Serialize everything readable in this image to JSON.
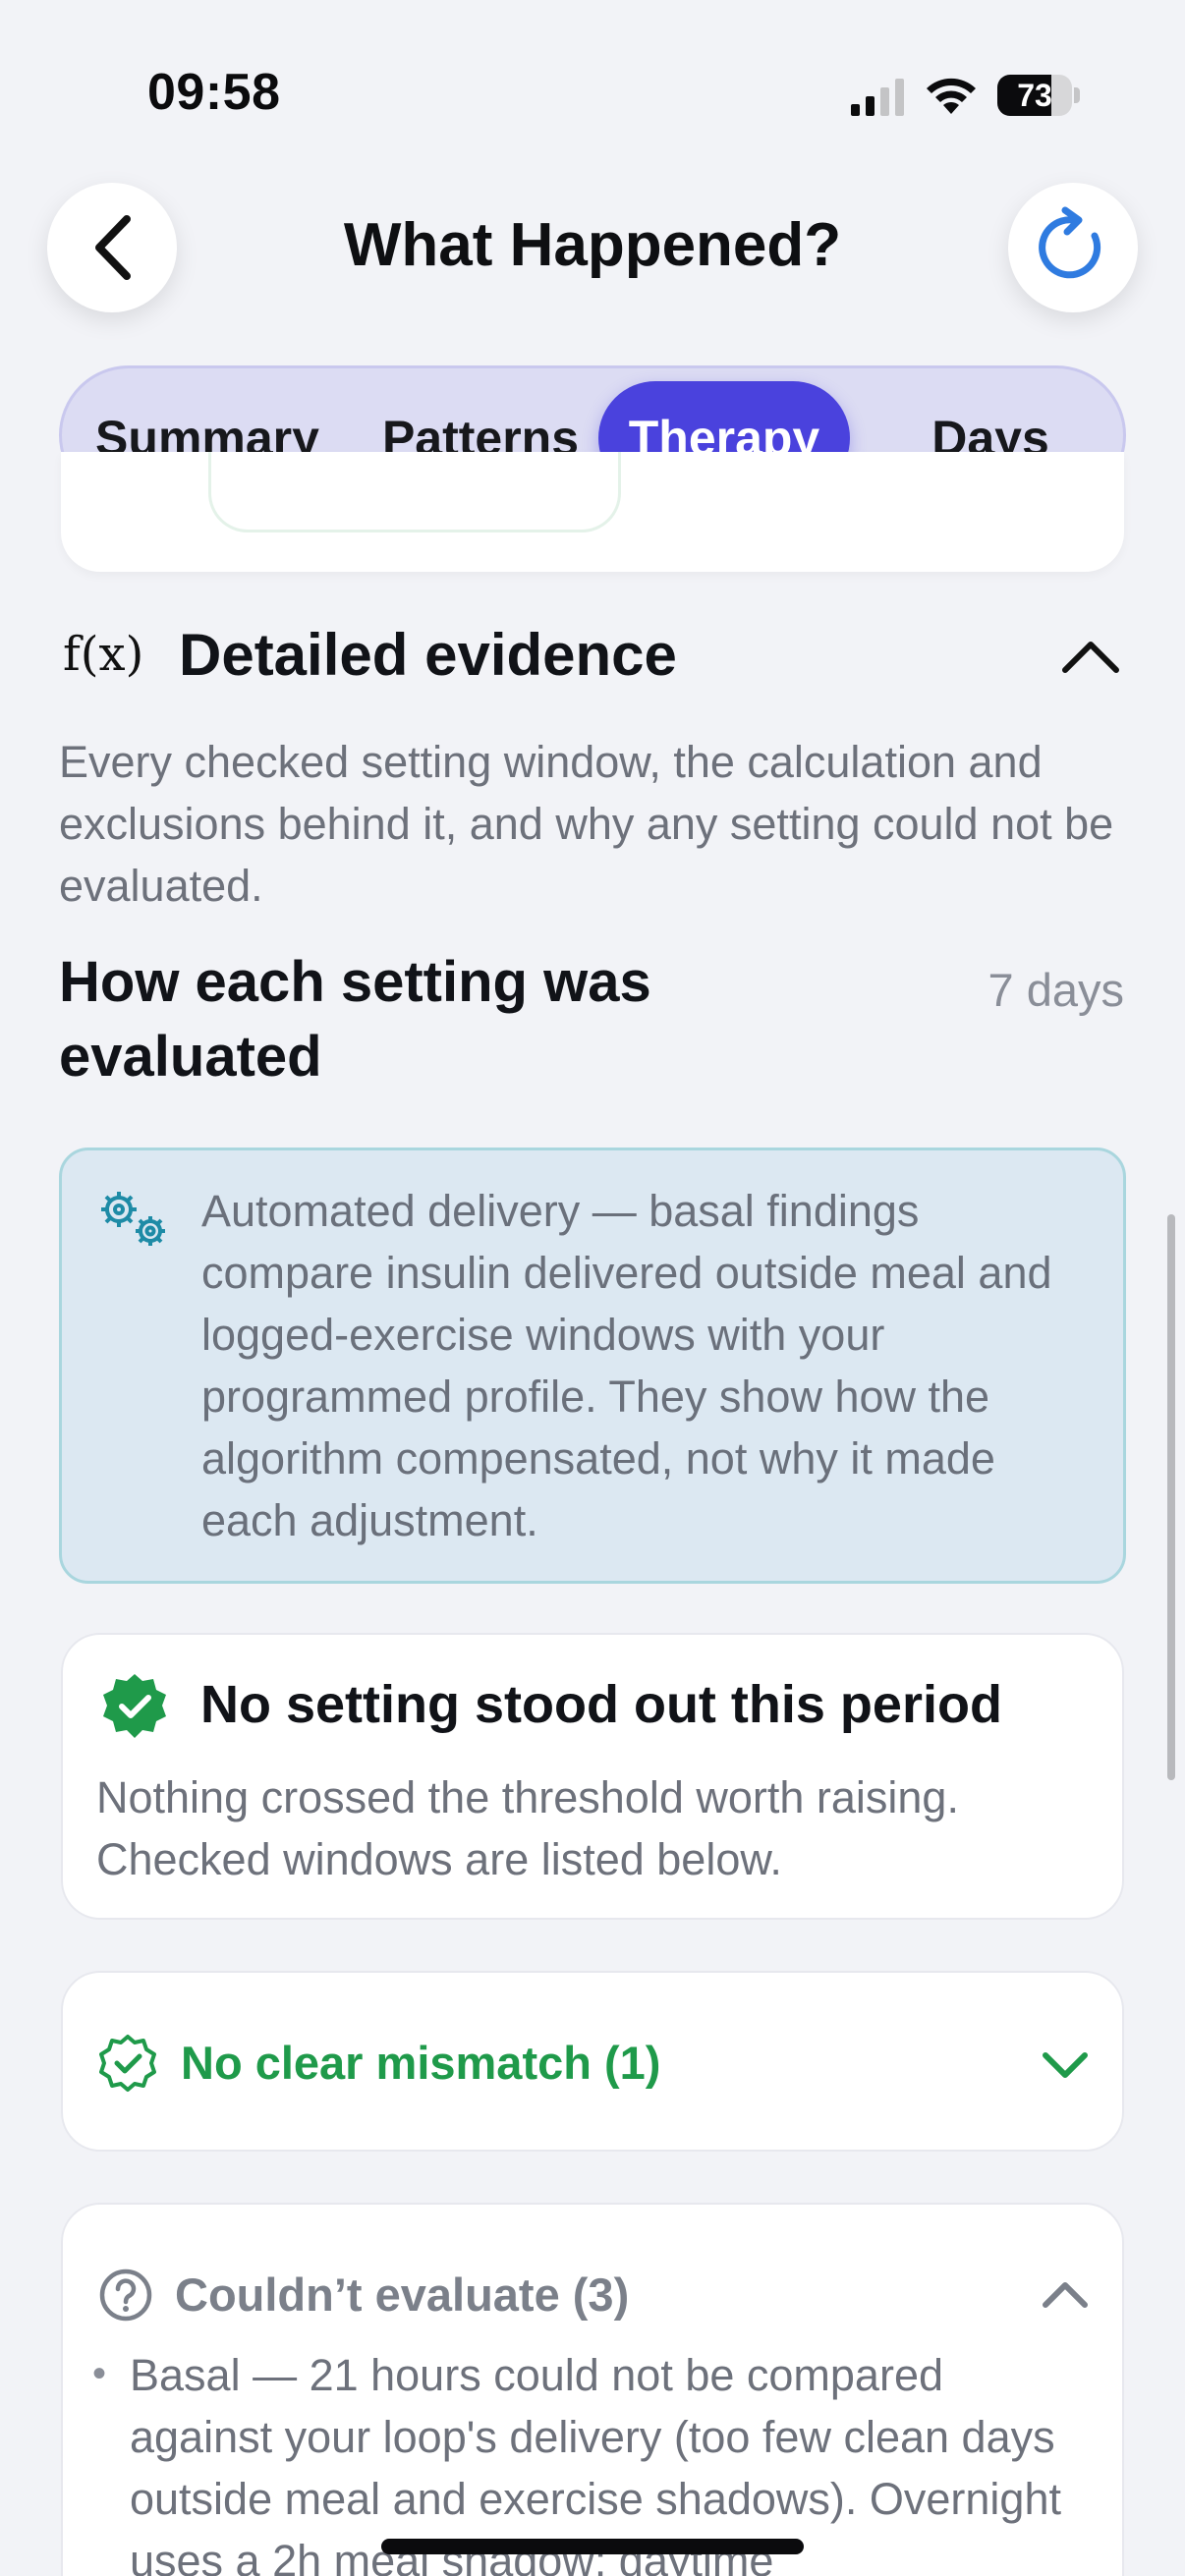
{
  "status_bar": {
    "time": "09:58",
    "battery": "73",
    "battery_level": 0.73
  },
  "header": {
    "title": "What Happened?",
    "back_icon": "chevron-left-icon",
    "refresh_icon": "refresh-icon"
  },
  "tabs": [
    {
      "label": "Summary",
      "active": false
    },
    {
      "label": "Patterns",
      "active": false
    },
    {
      "label": "Therapy",
      "active": true
    },
    {
      "label": "Days",
      "active": false
    }
  ],
  "section": {
    "icon_text": "f(x)",
    "title": "Detailed evidence",
    "description": "Every checked setting window, the calculation and exclusions behind it, and why any setting could not be evaluated."
  },
  "evaluation": {
    "title": "How each setting was evaluated",
    "period": "7 days"
  },
  "info_box": {
    "icon": "gears-icon",
    "text": "Automated delivery — basal findings compare insulin delivered outside meal and logged-exercise windows with your programmed profile. They show how the algorithm compensated, not why it made each adjustment."
  },
  "result_card": {
    "icon": "check-badge-icon",
    "title": "No setting stood out this period",
    "description": "Nothing crossed the threshold worth raising. Checked windows are listed below."
  },
  "groups": {
    "no_mismatch": {
      "label": "No clear mismatch (1)",
      "expanded": false
    },
    "couldnt_evaluate": {
      "label": "Couldn’t evaluate (3)",
      "expanded": true,
      "items": [
        "Basal — 21 hours could not be compared against your loop's delivery (too few clean days outside meal and exercise shadows). Overnight uses a 2h meal shadow; daytime"
      ]
    }
  },
  "colors": {
    "accent": "#4A42DD",
    "success": "#1F9A4A",
    "info_bg": "#DCE8F2",
    "info_icon": "#1E8BA6"
  }
}
